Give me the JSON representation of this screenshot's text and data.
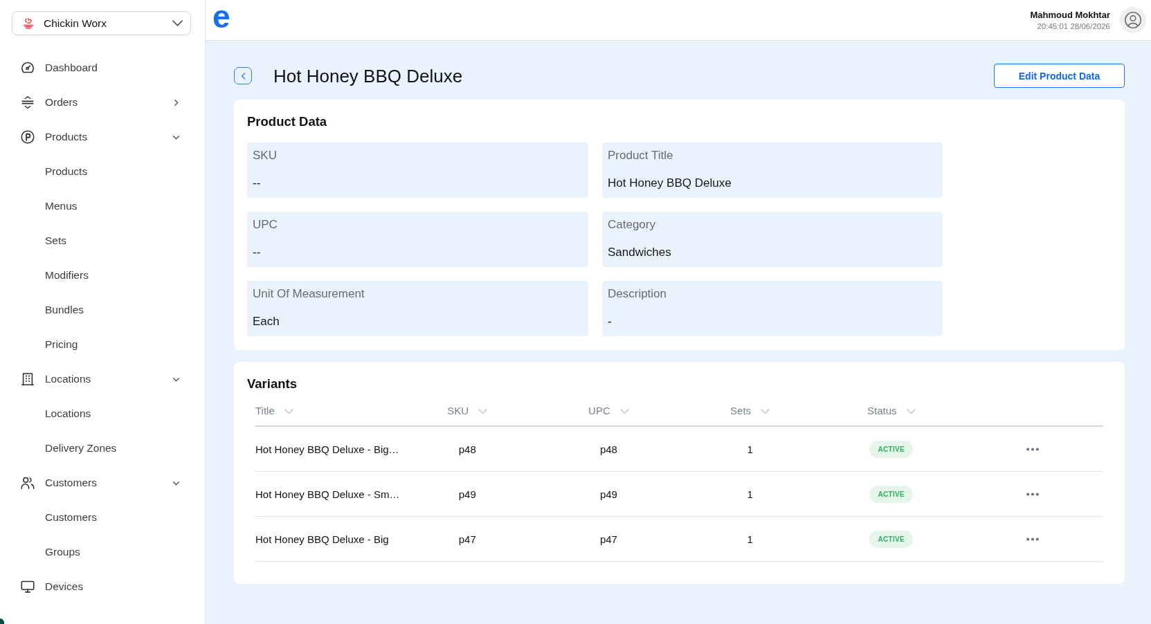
{
  "sidebar": {
    "store_selector": {
      "name": "Chickin Worx"
    },
    "items": [
      {
        "kind": "link",
        "label": "Dashboard"
      },
      {
        "kind": "group",
        "label": "Orders",
        "expanded": false
      },
      {
        "kind": "group",
        "label": "Products",
        "expanded": true,
        "children": [
          {
            "label": "Products"
          },
          {
            "label": "Menus"
          },
          {
            "label": "Sets"
          },
          {
            "label": "Modifiers"
          },
          {
            "label": "Bundles"
          },
          {
            "label": "Pricing"
          }
        ]
      },
      {
        "kind": "group",
        "label": "Locations",
        "expanded": true,
        "children": [
          {
            "label": "Locations"
          },
          {
            "label": "Delivery Zones"
          }
        ]
      },
      {
        "kind": "group",
        "label": "Customers",
        "expanded": true,
        "children": [
          {
            "label": "Customers"
          },
          {
            "label": "Groups"
          }
        ]
      },
      {
        "kind": "link",
        "label": "Devices"
      }
    ]
  },
  "top_bar": {
    "logo": "e",
    "user": {
      "name": "Mahmoud Mokhtar",
      "timestamp": "20:45:01 28/06/2026"
    }
  },
  "page": {
    "title": "Hot Honey BBQ Deluxe",
    "edit_button": "Edit Product Data"
  },
  "product_data": {
    "title": "Product Data",
    "fields": [
      {
        "label": "SKU",
        "value": "--"
      },
      {
        "label": "Product Title",
        "value": "Hot Honey BBQ Deluxe"
      },
      {
        "label": "UPC",
        "value": "--"
      },
      {
        "label": "Category",
        "value": "Sandwiches"
      },
      {
        "label": "Unit Of Measurement",
        "value": "Each"
      },
      {
        "label": "Description",
        "value": "-"
      }
    ]
  },
  "variants": {
    "title": "Variants",
    "table": {
      "columns": [
        "Title",
        "SKU",
        "UPC",
        "Sets",
        "Status"
      ],
      "rows": [
        {
          "title": "Hot Honey BBQ Deluxe - Big…",
          "sku": "p48",
          "upc": "p48",
          "sets": "1",
          "status": "ACTIVE"
        },
        {
          "title": "Hot Honey BBQ Deluxe - Sm…",
          "sku": "p49",
          "upc": "p49",
          "sets": "1",
          "status": "ACTIVE"
        },
        {
          "title": "Hot Honey BBQ Deluxe - Big",
          "sku": "p47",
          "upc": "p47",
          "sets": "1",
          "status": "ACTIVE"
        }
      ]
    }
  }
}
